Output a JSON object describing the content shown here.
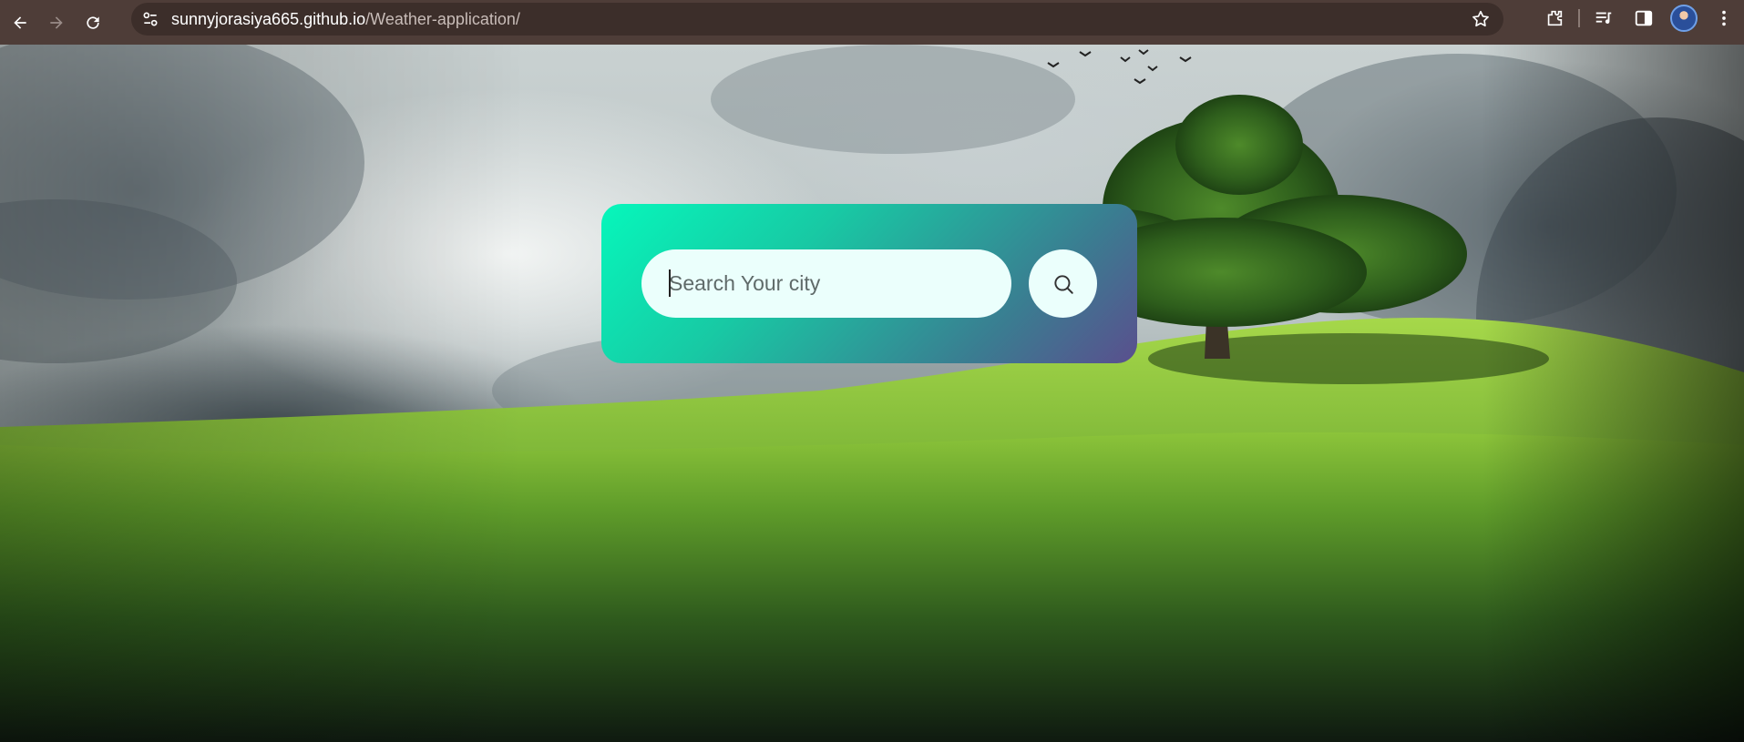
{
  "browser": {
    "url_host": "sunnyjorasiya665.github.io",
    "url_path": "/Weather-application/",
    "icons": [
      "back-arrow-icon",
      "forward-arrow-icon",
      "reload-icon",
      "site-settings-icon",
      "bookmark-star-icon",
      "extensions-icon",
      "media-controls-icon",
      "side-panel-icon",
      "profile-avatar",
      "more-menu-icon"
    ]
  },
  "search": {
    "placeholder": "Search Your city",
    "value": "",
    "button_icon": "search-icon"
  },
  "colors": {
    "card_gradient_start": "#06f7bb",
    "card_gradient_end": "#5a4f8e",
    "input_bg": "#ebfffc",
    "chrome_bg": "#4e3d38"
  }
}
